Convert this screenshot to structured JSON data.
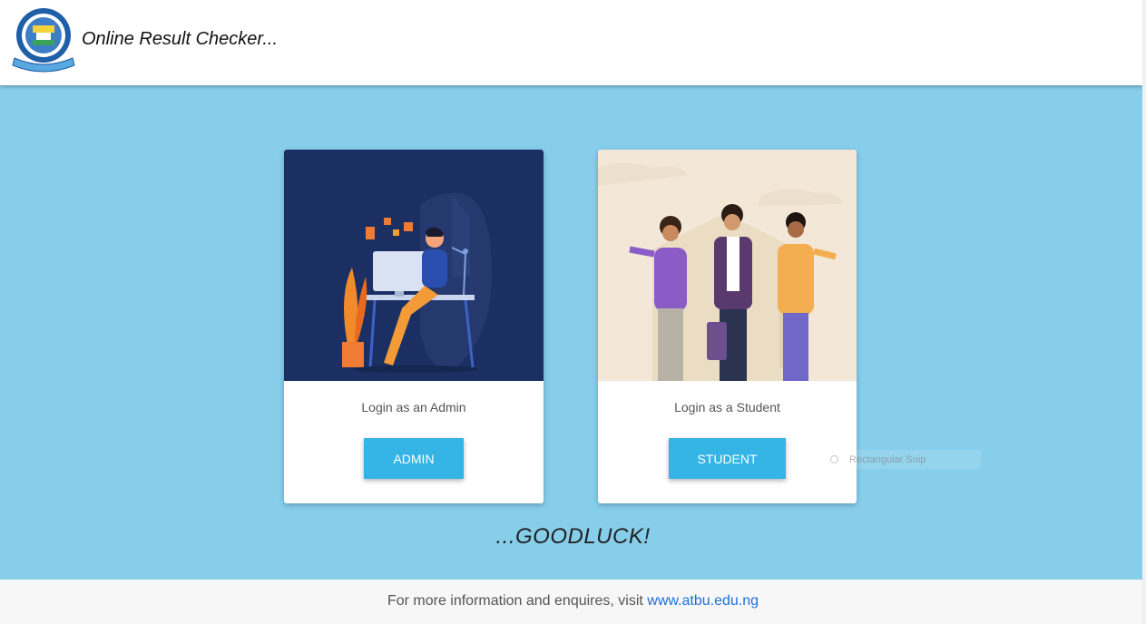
{
  "header": {
    "title": "Online Result Checker..."
  },
  "cards": {
    "admin": {
      "caption": "Login as an Admin",
      "button_label": "ADMIN"
    },
    "student": {
      "caption": "Login as a Student",
      "button_label": "STUDENT"
    }
  },
  "tagline": "...GOODLUCK!",
  "overlay": {
    "snip_label": "Rectangular Snip"
  },
  "footer": {
    "text": "For more information and enquires, visit",
    "link_text": "www.atbu.edu.ng"
  },
  "colors": {
    "background": "#87ceeb",
    "button": "#35b5e5",
    "admin_image_bg": "#1b2f63",
    "student_image_bg": "#f3e8d8",
    "link": "#1e6fd9"
  },
  "icons": [
    "university-logo",
    "admin-illustration",
    "students-illustration"
  ]
}
